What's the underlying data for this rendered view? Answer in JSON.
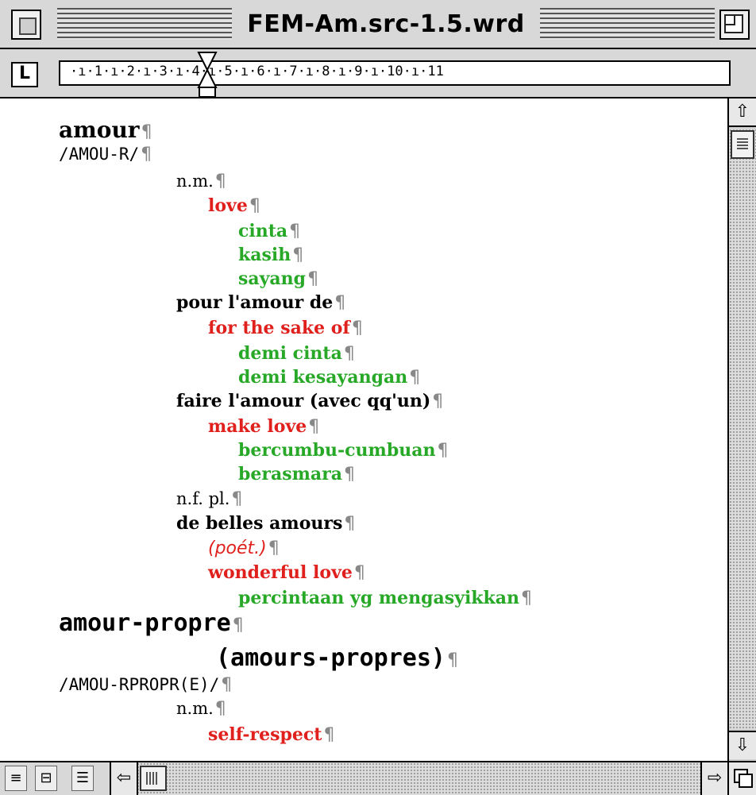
{
  "window": {
    "title": "FEM-Am.src-1.5.wrd"
  },
  "ruler": {
    "tab_label": "L",
    "numbers": "·ı·1·ı·2·ı·3·ı·4·ı·5·ı·6·ı·7·ı·8·ı·9·ı·10·ı·11"
  },
  "document": {
    "paragraph_mark": "¶",
    "lines": [
      {
        "text": "amour",
        "style": "head"
      },
      {
        "text": "/AMOU-R/",
        "style": "pron"
      },
      {
        "text": "n.m.",
        "style": "pos"
      },
      {
        "text": "love",
        "style": "en"
      },
      {
        "text": "cinta",
        "style": "id"
      },
      {
        "text": "kasih",
        "style": "id"
      },
      {
        "text": "sayang",
        "style": "id"
      },
      {
        "text": "pour l'amour de",
        "style": "phrase"
      },
      {
        "text": "for the sake of",
        "style": "en"
      },
      {
        "text": "demi cinta",
        "style": "id"
      },
      {
        "text": "demi kesayangan",
        "style": "id"
      },
      {
        "text": "faire l'amour (avec qq'un)",
        "style": "phrase"
      },
      {
        "text": "make love",
        "style": "en"
      },
      {
        "text": "bercumbu-cumbuan",
        "style": "id"
      },
      {
        "text": "berasmara",
        "style": "id"
      },
      {
        "text": "n.f. pl.",
        "style": "pos"
      },
      {
        "text": "de belles amours",
        "style": "phrase"
      },
      {
        "text": "(poét.)",
        "style": "note"
      },
      {
        "text": "wonderful love",
        "style": "en"
      },
      {
        "text": "percintaan yg mengasyikkan",
        "style": "id"
      },
      {
        "text": "amour-propre",
        "style": "head2"
      },
      {
        "text": "(amours-propres)",
        "style": "head2"
      },
      {
        "text": "/AMOU-RPROPR(E)/",
        "style": "pron"
      },
      {
        "text": "n.m.",
        "style": "pos"
      },
      {
        "text": "self-respect",
        "style": "en"
      }
    ]
  },
  "colors": {
    "english": "#e0201c",
    "indonesian": "#27a827",
    "french": "#000000",
    "paragraph_mark": "#888888"
  },
  "icons": {
    "close": "close-box-icon",
    "zoom": "zoom-box-icon",
    "scroll_up": "arrow-up-icon",
    "scroll_down": "arrow-down-icon",
    "scroll_left": "arrow-left-icon",
    "scroll_right": "arrow-right-icon"
  }
}
